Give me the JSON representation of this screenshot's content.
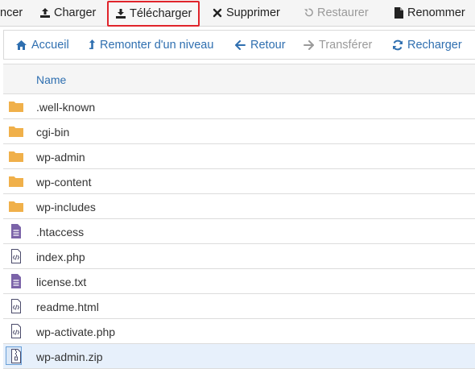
{
  "toolbar": {
    "items": [
      {
        "label": "ncer",
        "icon": "none",
        "state": "normal"
      },
      {
        "label": "Charger",
        "icon": "upload-icon",
        "state": "normal"
      },
      {
        "label": "Télécharger",
        "icon": "download-icon",
        "state": "highlighted"
      },
      {
        "label": "Supprimer",
        "icon": "close-icon",
        "state": "normal"
      },
      {
        "label": "Restaurer",
        "icon": "undo-icon",
        "state": "disabled"
      },
      {
        "label": "Renommer",
        "icon": "file-icon",
        "state": "normal"
      }
    ]
  },
  "nav": {
    "items": [
      {
        "label": "Accueil",
        "icon": "home-icon",
        "state": "normal"
      },
      {
        "label": "Remonter d'un niveau",
        "icon": "level-up-icon",
        "state": "normal"
      },
      {
        "label": "Retour",
        "icon": "arrow-left-icon",
        "state": "normal"
      },
      {
        "label": "Transférer",
        "icon": "arrow-right-icon",
        "state": "disabled"
      },
      {
        "label": "Recharger",
        "icon": "refresh-icon",
        "state": "normal"
      }
    ]
  },
  "table": {
    "column_name": "Name",
    "rows": [
      {
        "name": ".well-known",
        "type": "folder"
      },
      {
        "name": "cgi-bin",
        "type": "folder"
      },
      {
        "name": "wp-admin",
        "type": "folder"
      },
      {
        "name": "wp-content",
        "type": "folder"
      },
      {
        "name": "wp-includes",
        "type": "folder"
      },
      {
        "name": ".htaccess",
        "type": "text"
      },
      {
        "name": "index.php",
        "type": "code"
      },
      {
        "name": "license.txt",
        "type": "text"
      },
      {
        "name": "readme.html",
        "type": "code"
      },
      {
        "name": "wp-activate.php",
        "type": "code"
      },
      {
        "name": "wp-admin.zip",
        "type": "zip",
        "selected": true
      }
    ]
  },
  "colors": {
    "accent": "#2f6fb0",
    "highlight_border": "#e0242b",
    "folder": "#f0b04a",
    "text_file": "#7b63a8",
    "selected_row": "#e7f0fb"
  }
}
